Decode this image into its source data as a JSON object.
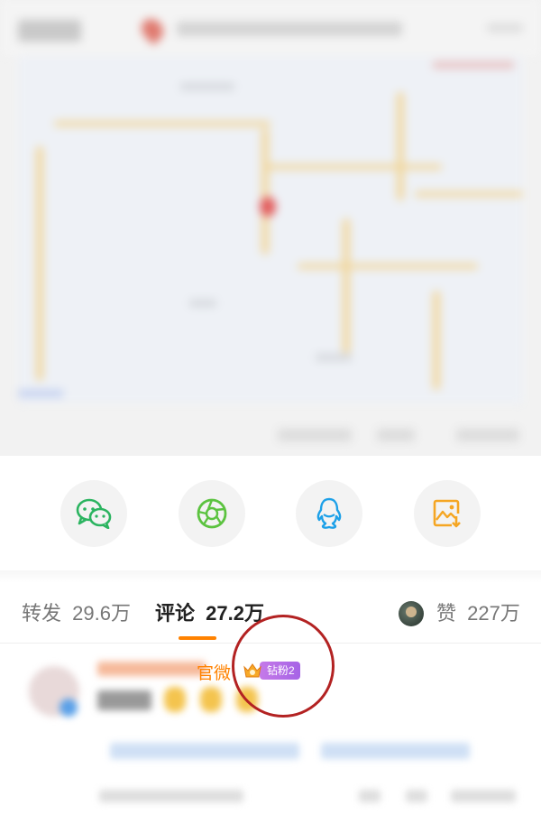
{
  "share": {
    "items": [
      {
        "name": "wechat",
        "icon": "wechat-icon",
        "color": "#2bb460"
      },
      {
        "name": "moments",
        "icon": "moments-aperture-icon",
        "color": "#5cc340"
      },
      {
        "name": "qq",
        "icon": "qq-penguin-icon",
        "color": "#1ca0e8"
      },
      {
        "name": "save-image",
        "icon": "save-image-icon",
        "color": "#f5a623"
      }
    ]
  },
  "tabs": {
    "forward": {
      "label": "转发",
      "count": "29.6万"
    },
    "comment": {
      "label": "评论",
      "count": "27.2万",
      "underline_color": "#ff8200"
    },
    "like": {
      "label": "赞",
      "count": "227万"
    }
  },
  "comment": {
    "name_visible_part": "官微",
    "badge_label": "钻粉2",
    "name_color": "#ff8200",
    "badge_color": "#b06ee6"
  },
  "annotation": {
    "highlight_color": "#b32222"
  }
}
